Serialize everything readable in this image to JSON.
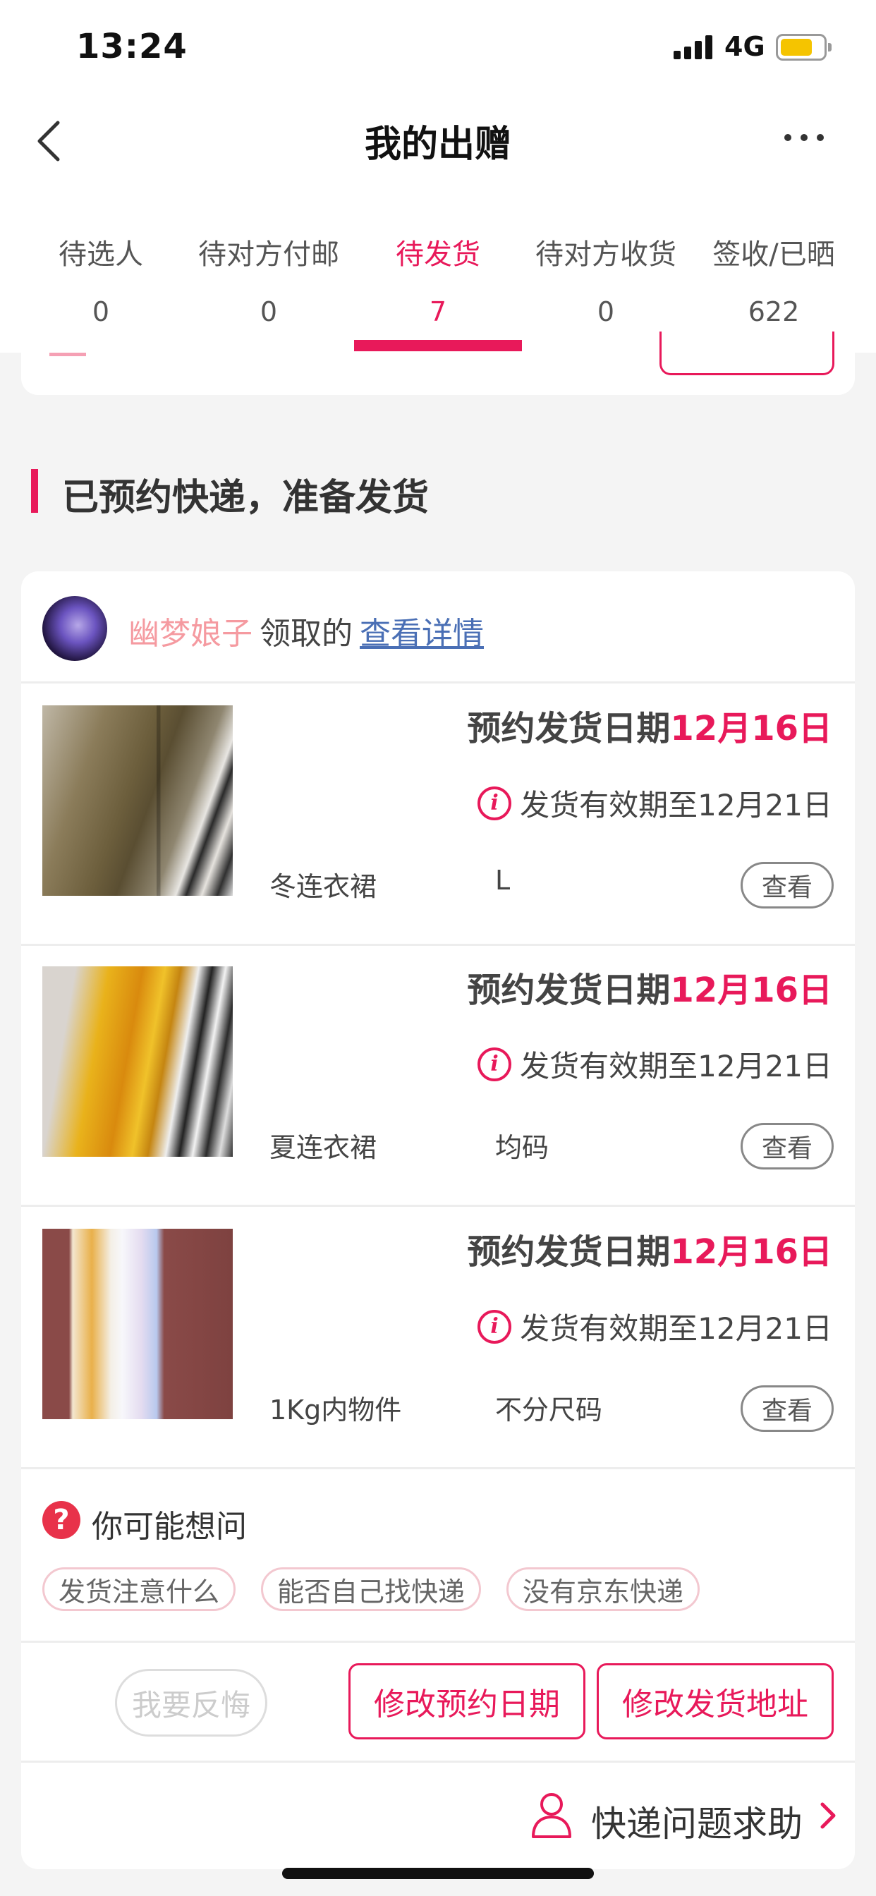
{
  "status_bar": {
    "time": "13:24",
    "network": "4G"
  },
  "nav": {
    "title": "我的出赠",
    "back_icon": "chevron-left-icon",
    "more_icon": "more-dots-icon"
  },
  "tabs": [
    {
      "label": "待选人",
      "count": "0"
    },
    {
      "label": "待对方付邮",
      "count": "0"
    },
    {
      "label": "待发货",
      "count": "7",
      "active": true
    },
    {
      "label": "待对方收货",
      "count": "0"
    },
    {
      "label": "签收/已晒",
      "count": "622"
    }
  ],
  "section": {
    "title": "已预约快递，准备发货"
  },
  "order": {
    "user_name": "幽梦娘子",
    "claim_text": "领取的",
    "detail_link": "查看详情",
    "items": [
      {
        "date_label": "预约发货日期",
        "date_value": "12月16日",
        "valid_text": "发货有效期至12月21日",
        "name": "冬连衣裙",
        "size": "L",
        "view": "查看"
      },
      {
        "date_label": "预约发货日期",
        "date_value": "12月16日",
        "valid_text": "发货有效期至12月21日",
        "name": "夏连衣裙",
        "size": "均码",
        "view": "查看"
      },
      {
        "date_label": "预约发货日期",
        "date_value": "12月16日",
        "valid_text": "发货有效期至12月21日",
        "name": "1Kg内物件",
        "size": "不分尺码",
        "view": "查看"
      }
    ]
  },
  "faq": {
    "icon_text": "?",
    "title": "你可能想问",
    "chips": [
      "发货注意什么",
      "能否自己找快递",
      "没有京东快递"
    ]
  },
  "actions": {
    "regret": "我要反悔",
    "change_date": "修改预约日期",
    "change_address": "修改发货地址"
  },
  "help": {
    "text": "快递问题求助",
    "icon": "person-icon"
  },
  "colors": {
    "accent": "#e8195a",
    "link": "#4a6fb5",
    "user_name": "#f59aa0"
  }
}
